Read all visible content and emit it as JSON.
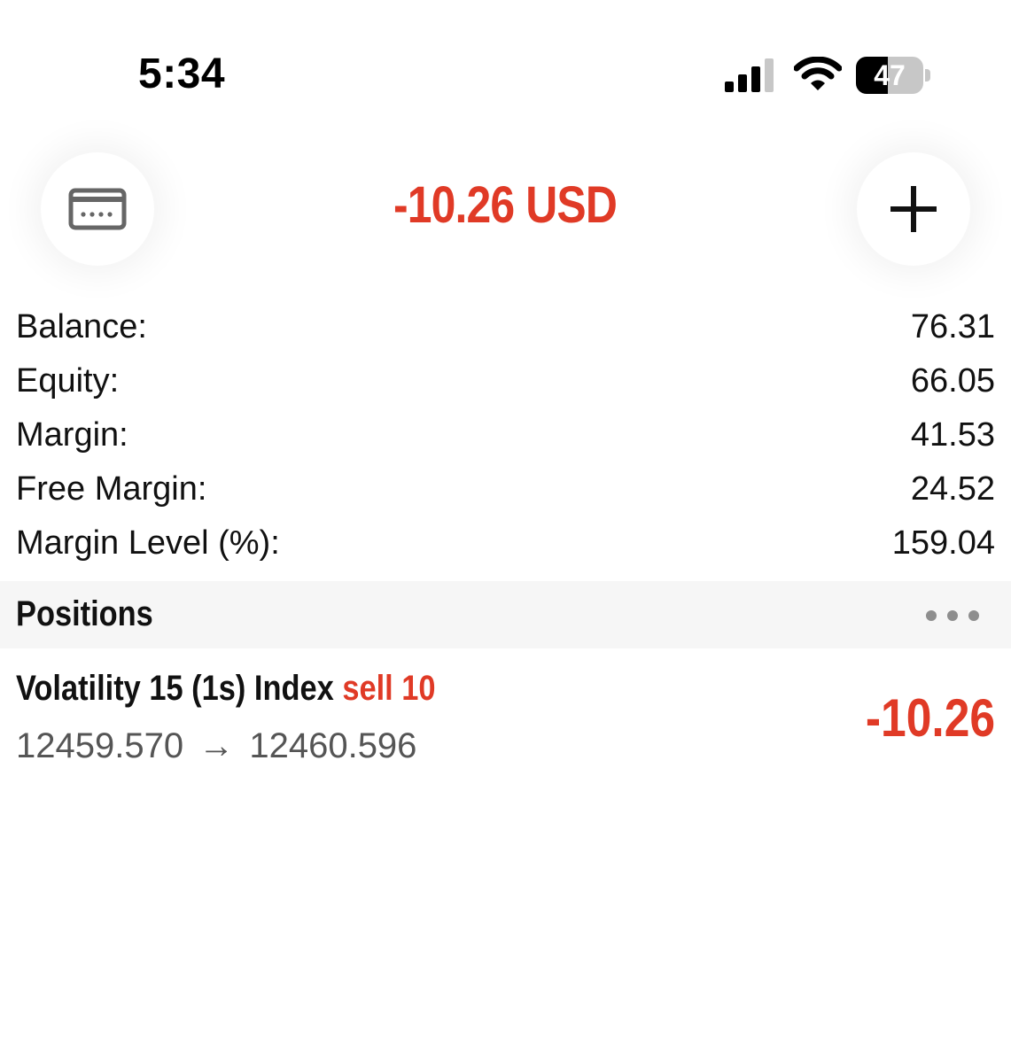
{
  "status_bar": {
    "time": "5:34",
    "battery": "47",
    "battery_level": 0.47,
    "icons": [
      "signal-icon",
      "wifi-icon",
      "battery-icon"
    ]
  },
  "header": {
    "total_pl": "-10.26 USD",
    "left_icon": "card-icon",
    "right_icon": "plus-icon"
  },
  "account": {
    "rows": [
      {
        "label": "Balance:",
        "value": "76.31"
      },
      {
        "label": "Equity:",
        "value": "66.05"
      },
      {
        "label": "Margin:",
        "value": "41.53"
      },
      {
        "label": "Free Margin:",
        "value": "24.52"
      },
      {
        "label": "Margin Level (%):",
        "value": "159.04"
      }
    ]
  },
  "positions": {
    "title": "Positions",
    "menu_icon": "more-icon",
    "items": [
      {
        "symbol": "Volatility 15 (1s) Index",
        "side_volume": "sell 10",
        "open_price": "12459.570",
        "arrow": "→",
        "current_price": "12460.596",
        "profit": "-10.26"
      }
    ]
  },
  "colors": {
    "loss": "#e03a26",
    "text": "#111111",
    "muted": "#555555",
    "section_bg": "#f6f6f6"
  }
}
